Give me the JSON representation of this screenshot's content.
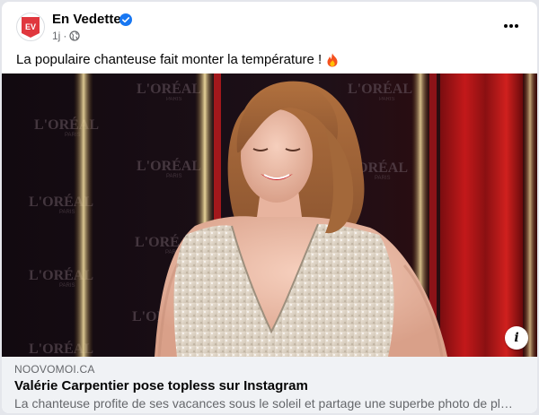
{
  "post": {
    "page_name": "En Vedette",
    "avatar_text": "EV",
    "time": "1j",
    "separator": "·",
    "caption": "La populaire chanteuse fait monter la température !",
    "caption_emoji": "fire-emoji",
    "verified_icon": "verified-badge-icon",
    "audience_icon": "globe-icon",
    "more_icon": "more-options-icon"
  },
  "media": {
    "watermark_text": "L'ORÉAL",
    "watermark_sub": "PARIS",
    "info_label": "i"
  },
  "link_preview": {
    "domain": "NOOVOMOI.CA",
    "title": "Valérie Carpentier pose topless sur Instagram",
    "description": "La chanteuse profite de ses vacances sous le soleil et partage une superbe photo de pla..."
  },
  "colors": {
    "brand_red": "#e0373e",
    "verified_blue": "#1877f2",
    "secondary_text": "#65676b",
    "link_bg": "#f0f2f5"
  }
}
